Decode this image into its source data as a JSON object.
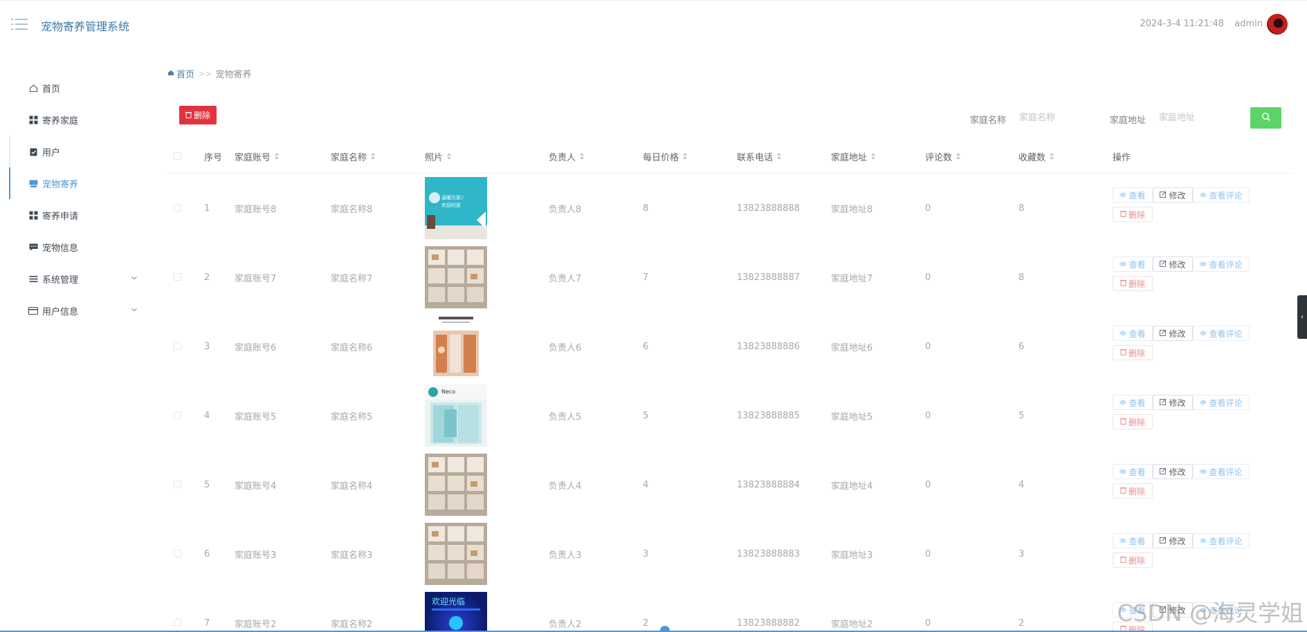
{
  "header": {
    "app_title": "宠物寄养管理系统",
    "datetime": "2024-3-4 11:21:48",
    "username": "admin"
  },
  "sidebar": {
    "items": [
      {
        "label": "首页",
        "icon": "home-icon"
      },
      {
        "label": "寄养家庭",
        "icon": "grid-icon"
      },
      {
        "label": "用户",
        "icon": "clipboard-icon"
      },
      {
        "label": "宠物寄养",
        "icon": "box-icon",
        "active": true
      },
      {
        "label": "寄养申请",
        "icon": "grid-icon"
      },
      {
        "label": "宠物信息",
        "icon": "message-icon"
      },
      {
        "label": "系统管理",
        "icon": "list-icon",
        "expandable": true
      },
      {
        "label": "用户信息",
        "icon": "card-icon",
        "expandable": true
      }
    ]
  },
  "breadcrumb": {
    "home": "首页",
    "separator": ">>",
    "current": "宠物寄养"
  },
  "toolbar": {
    "delete_label": "删除"
  },
  "search": {
    "name_label": "家庭名称",
    "name_placeholder": "家庭名称",
    "address_label": "家庭地址",
    "address_placeholder": "家庭地址"
  },
  "table": {
    "columns": [
      "序号",
      "家庭账号",
      "家庭名称",
      "照片",
      "负责人",
      "每日价格",
      "联系电话",
      "家庭地址",
      "评论数",
      "收藏数",
      "操作"
    ],
    "rows": [
      {
        "no": "1",
        "account": "家庭账号8",
        "name": "家庭名称8",
        "owner": "负责人8",
        "price": "8",
        "phone": "13823888888",
        "address": "家庭地址8",
        "comments": "0",
        "favorites": "8",
        "photo": "teal-wall"
      },
      {
        "no": "2",
        "account": "家庭账号7",
        "name": "家庭名称7",
        "owner": "负责人7",
        "price": "7",
        "phone": "13823888887",
        "address": "家庭地址7",
        "comments": "0",
        "favorites": "8",
        "photo": "cat-cages"
      },
      {
        "no": "3",
        "account": "家庭账号6",
        "name": "家庭名称6",
        "owner": "负责人6",
        "price": "6",
        "phone": "13823888886",
        "address": "家庭地址6",
        "comments": "0",
        "favorites": "6",
        "photo": "orange-room"
      },
      {
        "no": "4",
        "account": "家庭账号5",
        "name": "家庭名称5",
        "owner": "负责人5",
        "price": "5",
        "phone": "13823888885",
        "address": "家庭地址5",
        "comments": "0",
        "favorites": "5",
        "photo": "storefront"
      },
      {
        "no": "5",
        "account": "家庭账号4",
        "name": "家庭名称4",
        "owner": "负责人4",
        "price": "4",
        "phone": "13823888884",
        "address": "家庭地址4",
        "comments": "0",
        "favorites": "4",
        "photo": "cat-cages"
      },
      {
        "no": "6",
        "account": "家庭账号3",
        "name": "家庭名称3",
        "owner": "负责人3",
        "price": "3",
        "phone": "13823888883",
        "address": "家庭地址3",
        "comments": "0",
        "favorites": "3",
        "photo": "cat-cages"
      },
      {
        "no": "7",
        "account": "家庭账号2",
        "name": "家庭名称2",
        "owner": "负责人2",
        "price": "2",
        "phone": "13823888882",
        "address": "家庭地址2",
        "comments": "0",
        "favorites": "2",
        "photo": "neon-sign"
      }
    ],
    "actions": {
      "view": "查看",
      "edit": "修改",
      "comments": "查看评论",
      "delete": "删除"
    }
  },
  "watermark": "CSDN @海灵学姐",
  "colors": {
    "accent": "#4d97d6",
    "danger": "#e1333f",
    "search_button": "#5bd46a"
  }
}
